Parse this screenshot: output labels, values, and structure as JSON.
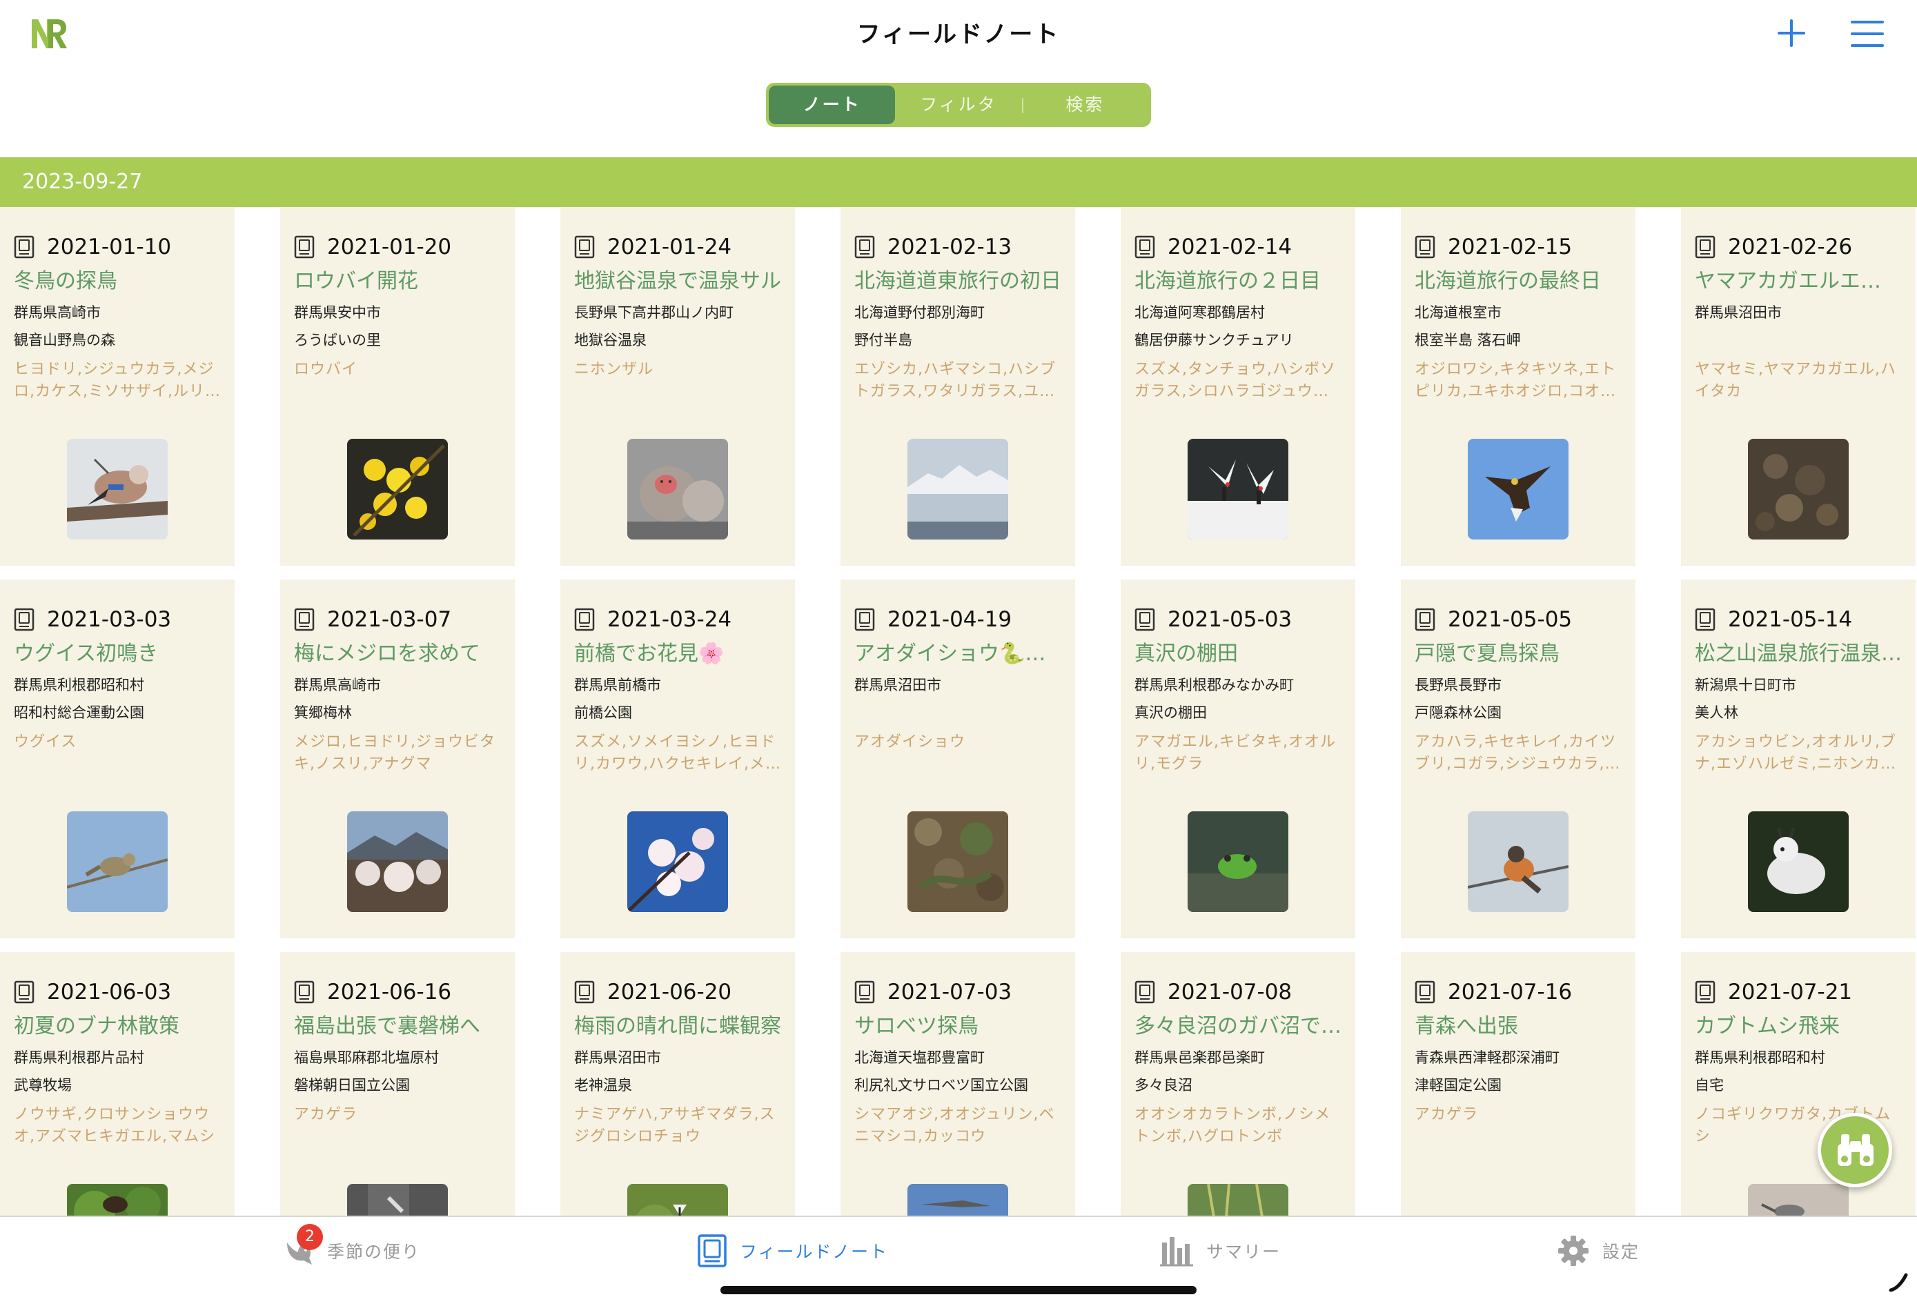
{
  "app": {
    "logo_text": "NR",
    "title": "フィールドノート",
    "accent_color": "#a8cc54",
    "active_segment_color": "#4f8a55",
    "link_color": "#2f7fde"
  },
  "segments": [
    {
      "label": "ノート",
      "active": true
    },
    {
      "label": "フィルタ",
      "active": false
    },
    {
      "label": "検索",
      "active": false
    }
  ],
  "date_header": "2023-09-27",
  "cards": [
    {
      "date": "2021-01-10",
      "title": "冬鳥の探鳥",
      "prefecture": "群馬県高崎市",
      "place": "観音山野鳥の森",
      "species": "ヒヨドリ,シジュウカラ,メジロ,カケス,ミソサザイ,ルリ…",
      "photo": "jay-bird"
    },
    {
      "date": "2021-01-20",
      "title": "ロウバイ開花",
      "prefecture": "群馬県安中市",
      "place": "ろうばいの里",
      "species": "ロウバイ",
      "photo": "wintersweet-flower"
    },
    {
      "date": "2021-01-24",
      "title": "地獄谷温泉で温泉サル",
      "prefecture": "長野県下高井郡山ノ内町",
      "place": "地獄谷温泉",
      "species": "ニホンザル",
      "photo": "snow-monkey"
    },
    {
      "date": "2021-02-13",
      "title": "北海道道東旅行の初日",
      "prefecture": "北海道野付郡別海町",
      "place": "野付半島",
      "species": "エゾシカ,ハギマシコ,ハシブトガラス,ワタリガラス,ユ…",
      "photo": "snowy-mountain"
    },
    {
      "date": "2021-02-14",
      "title": "北海道旅行の２日目",
      "prefecture": "北海道阿寒郡鶴居村",
      "place": "鶴居伊藤サンクチュアリ",
      "species": "スズメ,タンチョウ,ハシボソガラス,シロハラゴジュウカ…",
      "photo": "red-crowned-cranes"
    },
    {
      "date": "2021-02-15",
      "title": "北海道旅行の最終日",
      "prefecture": "北海道根室市",
      "place": "根室半島 落石岬",
      "species": "オジロワシ,キタキツネ,エトピリカ,ユキホオジロ,コオ…",
      "photo": "sea-eagle"
    },
    {
      "date": "2021-02-26",
      "title": "ヤマアカガエルエ…",
      "prefecture": "群馬県沼田市",
      "place": "",
      "species": "ヤマセミ,ヤマアカガエル,ハイタカ",
      "photo": "frog-eggs"
    },
    {
      "date": "2021-03-03",
      "title": "ウグイス初鳴き",
      "prefecture": "群馬県利根郡昭和村",
      "place": "昭和村総合運動公園",
      "species": "ウグイス",
      "photo": "bush-warbler"
    },
    {
      "date": "2021-03-07",
      "title": "梅にメジロを求めて",
      "prefecture": "群馬県高崎市",
      "place": "箕郷梅林",
      "species": "メジロ,ヒヨドリ,ジョウビタキ,ノスリ,アナグマ",
      "photo": "plum-grove"
    },
    {
      "date": "2021-03-24",
      "title": "前橋でお花見🌸",
      "prefecture": "群馬県前橋市",
      "place": "前橋公園",
      "species": "スズメ,ソメイヨシノ,ヒヨドリ,カワウ,ハクセキレイ,メ…",
      "photo": "cherry-blossom"
    },
    {
      "date": "2021-04-19",
      "title": "アオダイショウ🐍…",
      "prefecture": "群馬県沼田市",
      "place": "",
      "species": "アオダイショウ",
      "photo": "rat-snake"
    },
    {
      "date": "2021-05-03",
      "title": "真沢の棚田",
      "prefecture": "群馬県利根郡みなかみ町",
      "place": "真沢の棚田",
      "species": "アマガエル,キビタキ,オオルリ,モグラ",
      "photo": "tree-frog"
    },
    {
      "date": "2021-05-05",
      "title": "戸隠で夏鳥探鳥",
      "prefecture": "長野県長野市",
      "place": "戸隠森林公園",
      "species": "アカハラ,キセキレイ,カイツブリ,コガラ,シジュウカラ,…",
      "photo": "brown-thrush"
    },
    {
      "date": "2021-05-14",
      "title": "松之山温泉旅行温泉…",
      "prefecture": "新潟県十日町市",
      "place": "美人林",
      "species": "アカショウビン,オオルリ,ブナ,エゾハルゼミ,ニホンカ…",
      "photo": "serow"
    },
    {
      "date": "2021-06-03",
      "title": "初夏のブナ林散策",
      "prefecture": "群馬県利根郡片品村",
      "place": "武尊牧場",
      "species": "ノウサギ,クロサンショウウオ,アズマヒキガエル,マムシ",
      "photo": "forest-bird"
    },
    {
      "date": "2021-06-16",
      "title": "福島出張で裏磐梯へ",
      "prefecture": "福島県耶麻郡北塩原村",
      "place": "磐梯朝日国立公園",
      "species": "アカゲラ",
      "photo": "woodpecker"
    },
    {
      "date": "2021-06-20",
      "title": "梅雨の晴れ間に蝶観察",
      "prefecture": "群馬県沼田市",
      "place": "老神温泉",
      "species": "ナミアゲハ,アサギマダラ,スジグロシロチョウ",
      "photo": "butterfly"
    },
    {
      "date": "2021-07-03",
      "title": "サロベツ探鳥",
      "prefecture": "北海道天塩郡豊富町",
      "place": "利尻礼文サロベツ国立公園",
      "species": "シマアオジ,オオジュリン,ベニマシコ,カッコウ",
      "photo": "cuckoo"
    },
    {
      "date": "2021-07-08",
      "title": "多々良沼のガバ沼で…",
      "prefecture": "群馬県邑楽郡邑楽町",
      "place": "多々良沼",
      "species": "オオシオカラトンボ,ノシメトンボ,ハグロトンボ",
      "photo": "dragonfly"
    },
    {
      "date": "2021-07-16",
      "title": "青森へ出張",
      "prefecture": "青森県西津軽郡深浦町",
      "place": "津軽国定公園",
      "species": "アカゲラ",
      "photo": "none"
    },
    {
      "date": "2021-07-21",
      "title": "カブトムシ飛来",
      "prefecture": "群馬県利根郡昭和村",
      "place": "自宅",
      "species": "ノコギリクワガタ,カブトムシ",
      "photo": "stag-beetle"
    }
  ],
  "fab": {
    "icon": "binoculars-icon"
  },
  "tabs": [
    {
      "label": "季節の便り",
      "icon": "bird-icon",
      "badge": "2",
      "active": false
    },
    {
      "label": "フィールドノート",
      "icon": "notebook-icon",
      "active": true
    },
    {
      "label": "サマリー",
      "icon": "bar-chart-icon",
      "active": false
    },
    {
      "label": "設定",
      "icon": "gear-icon",
      "active": false
    }
  ]
}
